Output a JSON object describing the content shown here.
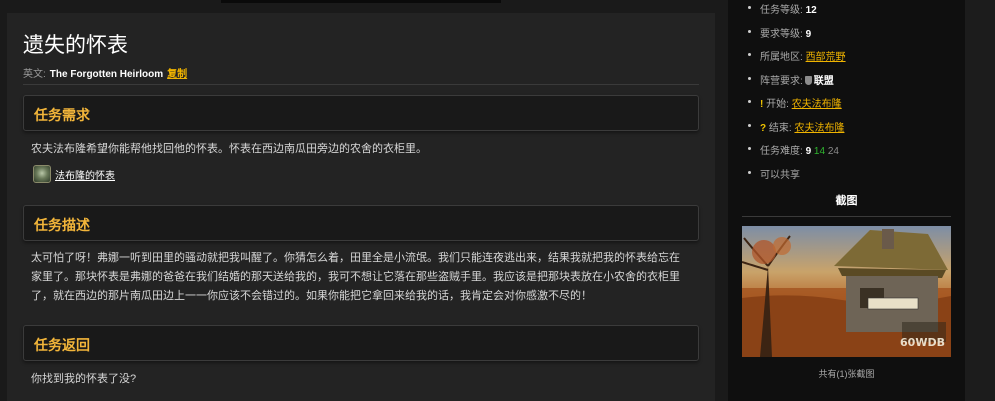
{
  "quest": {
    "title": "遗失的怀表",
    "english_label": "英文:",
    "english_name": "The Forgotten Heirloom",
    "copy_label": "复制"
  },
  "sections": {
    "requirement": {
      "heading": "任务需求",
      "text": "农夫法布隆希望你能帮他找回他的怀表。怀表在西边南瓜田旁边的农舍的衣柜里。",
      "item": {
        "name": "法布隆的怀表",
        "icon": "pocket-watch-icon"
      }
    },
    "description": {
      "heading": "任务描述",
      "lines": [
        "太可怕了呀！弗娜一听到田里的骚动就把我叫醒了。你猜怎么着，田里全是小流氓。我们只能连夜逃出来，结果我就把我的怀表给忘在",
        "家里了。那块怀表是弗娜的爸爸在我们结婚的那天送给我的，我可不想让它落在那些盗贼手里。我应该是把那块表放在小农舍的衣柜里",
        "了，就在西边的那片南瓜田边上一一你应该不会错过的。如果你能把它拿回来给我的话，我肯定会对你感激不尽的！"
      ]
    },
    "return": {
      "heading": "任务返回",
      "text": "你找到我的怀表了没?"
    }
  },
  "sidebar": {
    "quest_level_label": "任务等级:",
    "quest_level_value": "12",
    "req_level_label": "要求等级:",
    "req_level_value": "9",
    "zone_label": "所属地区:",
    "zone_value": "西部荒野",
    "faction_label": "阵营要求:",
    "faction_value": "联盟",
    "faction_icon": "alliance-shield-icon",
    "start_label": "开始:",
    "start_value": "农夫法布隆",
    "start_icon": "exclamation-icon",
    "end_label": "结束:",
    "end_value": "农夫法布隆",
    "end_icon": "question-icon",
    "difficulty_label": "任务难度:",
    "difficulty_values": [
      "9",
      "14",
      "24"
    ],
    "shareable": "可以共享",
    "screenshot_title": "截图",
    "screenshot_watermark": "60WDB",
    "screenshot_count": "共有(1)张截图"
  },
  "colors": {
    "accent": "#f2b53a",
    "link": "#f0b400",
    "difficulty_green": "#2fb52f",
    "difficulty_gray": "#8a8a8a"
  }
}
